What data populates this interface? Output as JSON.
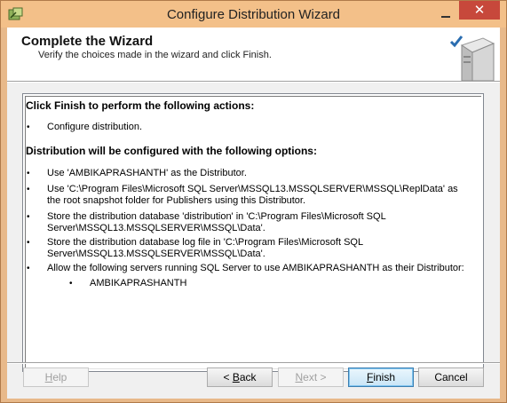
{
  "window": {
    "title": "Configure Distribution Wizard",
    "close_glyph": "✕",
    "accent_color": "#f3c089"
  },
  "header": {
    "title": "Complete the Wizard",
    "subtitle": "Verify the choices made in the wizard and click Finish."
  },
  "summary": {
    "actions_heading": "Click Finish to perform the following actions:",
    "actions": [
      "Configure distribution."
    ],
    "options_heading": "Distribution will be configured with the following options:",
    "options": [
      "Use 'AMBIKAPRASHANTH' as the Distributor.",
      "Use 'C:\\Program Files\\Microsoft SQL Server\\MSSQL13.MSSQLSERVER\\MSSQL\\ReplData' as the root snapshot folder for Publishers using this Distributor.",
      "Store the distribution database 'distribution' in 'C:\\Program Files\\Microsoft SQL Server\\MSSQL13.MSSQLSERVER\\MSSQL\\Data'.",
      "Store the distribution database log file in 'C:\\Program Files\\Microsoft SQL Server\\MSSQL13.MSSQLSERVER\\MSSQL\\Data'.",
      "Allow the following servers running SQL Server to use AMBIKAPRASHANTH as their Distributor:"
    ],
    "servers": [
      "AMBIKAPRASHANTH"
    ],
    "bullet": "•"
  },
  "buttons": {
    "help": {
      "label": "Help",
      "accel": "H",
      "rest": "elp"
    },
    "back": {
      "prefix": "< ",
      "accel": "B",
      "rest": "ack"
    },
    "next": {
      "accel": "N",
      "rest": "ext >"
    },
    "finish": {
      "accel": "F",
      "rest": "inish"
    },
    "cancel": {
      "label": "Cancel"
    }
  }
}
